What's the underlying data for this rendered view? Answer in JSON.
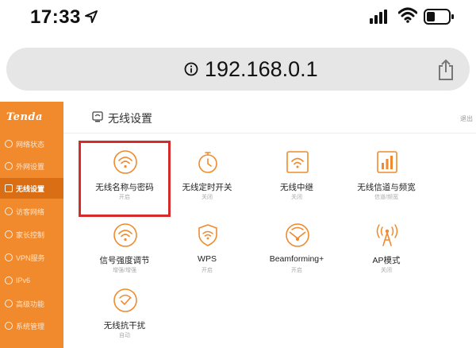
{
  "status_bar": {
    "time": "17:33"
  },
  "url_bar": {
    "address": "192.168.0.1"
  },
  "sidebar": {
    "brand": "Tenda",
    "items": [
      {
        "label": "网络状态",
        "active": false
      },
      {
        "label": "外网设置",
        "active": false
      },
      {
        "label": "无线设置",
        "active": true
      },
      {
        "label": "访客网络",
        "active": false
      },
      {
        "label": "家长控制",
        "active": false
      },
      {
        "label": "VPN服务",
        "active": false
      },
      {
        "label": "IPv6",
        "active": false
      },
      {
        "label": "高级功能",
        "active": false
      },
      {
        "label": "系统管理",
        "active": false
      }
    ]
  },
  "content": {
    "title": "无线设置",
    "logout": "退出",
    "tiles": [
      {
        "icon": "wifi-icon",
        "label": "无线名称与密码",
        "status": "开启"
      },
      {
        "icon": "timer-icon",
        "label": "无线定时开关",
        "status": "关闭"
      },
      {
        "icon": "repeater-icon",
        "label": "无线中继",
        "status": "关闭"
      },
      {
        "icon": "channel-icon",
        "label": "无线信道与频宽",
        "status": "信道/频宽"
      },
      {
        "icon": "signal-strength-icon",
        "label": "信号强度调节",
        "status": "增强/增强"
      },
      {
        "icon": "wps-shield-icon",
        "label": "WPS",
        "status": "开启"
      },
      {
        "icon": "beamforming-icon",
        "label": "Beamforming+",
        "status": "开启"
      },
      {
        "icon": "ap-antenna-icon",
        "label": "AP模式",
        "status": "关闭"
      },
      {
        "icon": "anti-interference-icon",
        "label": "无线抗干扰",
        "status": "自动"
      }
    ]
  },
  "colors": {
    "brand_orange": "#f08a2c",
    "sidebar_active": "#d96e14",
    "highlight_red": "#d42b2b"
  }
}
